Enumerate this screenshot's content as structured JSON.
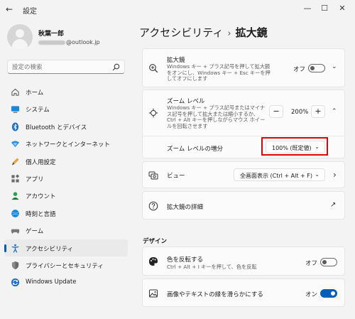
{
  "window": {
    "title": "設定",
    "back_glyph": "←",
    "minimize_glyph": "—",
    "maximize_glyph": "☐",
    "close_glyph": "✕"
  },
  "profile": {
    "name": "秋葉一郎",
    "email_suffix": "@outlook.jp"
  },
  "search": {
    "placeholder": "設定の検索"
  },
  "sidebar": {
    "items": [
      {
        "label": "ホーム",
        "icon": "home-icon"
      },
      {
        "label": "システム",
        "icon": "system-icon"
      },
      {
        "label": "Bluetooth とデバイス",
        "icon": "bluetooth-icon"
      },
      {
        "label": "ネットワークとインターネット",
        "icon": "network-icon"
      },
      {
        "label": "個人用設定",
        "icon": "personalization-icon"
      },
      {
        "label": "アプリ",
        "icon": "apps-icon"
      },
      {
        "label": "アカウント",
        "icon": "accounts-icon"
      },
      {
        "label": "時刻と言語",
        "icon": "time-language-icon"
      },
      {
        "label": "ゲーム",
        "icon": "gaming-icon"
      },
      {
        "label": "アクセシビリティ",
        "icon": "accessibility-icon",
        "active": true
      },
      {
        "label": "プライバシーとセキュリティ",
        "icon": "privacy-icon"
      },
      {
        "label": "Windows Update",
        "icon": "windows-update-icon"
      }
    ]
  },
  "breadcrumb": {
    "parent": "アクセシビリティ",
    "separator": "›",
    "current": "拡大鏡"
  },
  "magnifier": {
    "title": "拡大鏡",
    "description": "Windows キー + プラス記号を押して拡大鏡をオンにし、Windows キー + Esc キーを押してオフにします",
    "state": "オフ",
    "expand_glyph": "⌄"
  },
  "zoom_level": {
    "title": "ズーム レベル",
    "description": "Windows キー + プラス記号またはマイナス記号を押して拡大または縮小するか、Ctrl + Alt キーを押しながらマウス ホイールを回転させます",
    "minus": "−",
    "value": "200%",
    "plus": "+",
    "collapse_glyph": "⌃"
  },
  "zoom_increment": {
    "title": "ズーム レベルの増分",
    "value": "100% (既定値)"
  },
  "view": {
    "title": "ビュー",
    "value": "全画面表示 (Ctrl + Alt + F)",
    "arrow_glyph": "›"
  },
  "details": {
    "title": "拡大鏡の詳細",
    "link_glyph": "↗"
  },
  "design_section": {
    "heading": "デザイン"
  },
  "invert_colors": {
    "title": "色を反転する",
    "description": "Ctrl + Alt + I キーを押して、色を反転",
    "state": "オフ"
  },
  "smooth_edges": {
    "title": "画像やテキストの縁を滑らかにする",
    "state": "オン"
  },
  "colors": {
    "accent": "#005fb8",
    "highlight_border": "#e00000",
    "background": "#f3f3f3",
    "card": "#fbfbfb"
  }
}
